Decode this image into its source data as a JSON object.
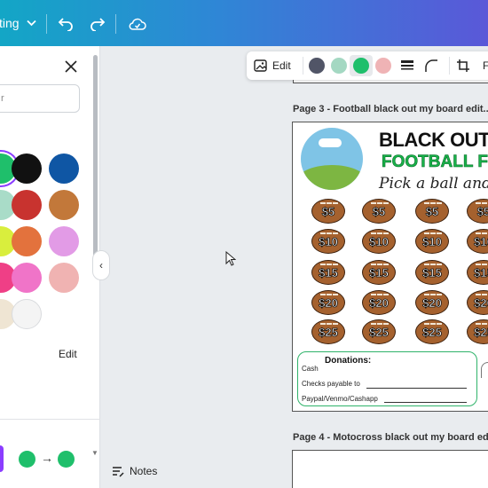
{
  "topbar": {
    "menu_label": "ting",
    "icons": [
      "chevron-down-icon",
      "undo-icon",
      "redo-icon",
      "cloud-save-icon"
    ]
  },
  "panel": {
    "search_placeholder": "r",
    "edit_label": "Edit",
    "colors": [
      "#1fbf6b",
      "#111111",
      "#0f56a4",
      "#a9dcc8",
      "#c8332f",
      "#c2783a",
      "#d9ee3d",
      "#e3723d",
      "#e29be6",
      "#ef3f86",
      "#f074c8",
      "#f0b3b2",
      "#efe5d3",
      "#f4f4f4"
    ],
    "gradient_from": "#1fbf6b",
    "gradient_to": "#1fbf6b"
  },
  "context_toolbar": {
    "edit_label": "Edit",
    "colors": [
      "#515567",
      "#a4d8c2",
      "#1fbf6b",
      "#efb3b5"
    ],
    "trailing_label": "F"
  },
  "pages": {
    "page3_label": "Page 3 - Football black out my board edit...",
    "page4_label": "Page 4 - Motocross black out my board ed..."
  },
  "board": {
    "title": "BLACK OUT I",
    "subtitle": "FOOTBALL FU",
    "script": "Pick a ball and p",
    "amounts": [
      "$5",
      "$10",
      "$15",
      "$20",
      "$25"
    ],
    "donations_heading": "Donations:",
    "donation_lines": [
      "Cash",
      "Checks payable to",
      "Paypal/Venmo/Cashapp"
    ]
  },
  "footer": {
    "notes_label": "Notes"
  }
}
